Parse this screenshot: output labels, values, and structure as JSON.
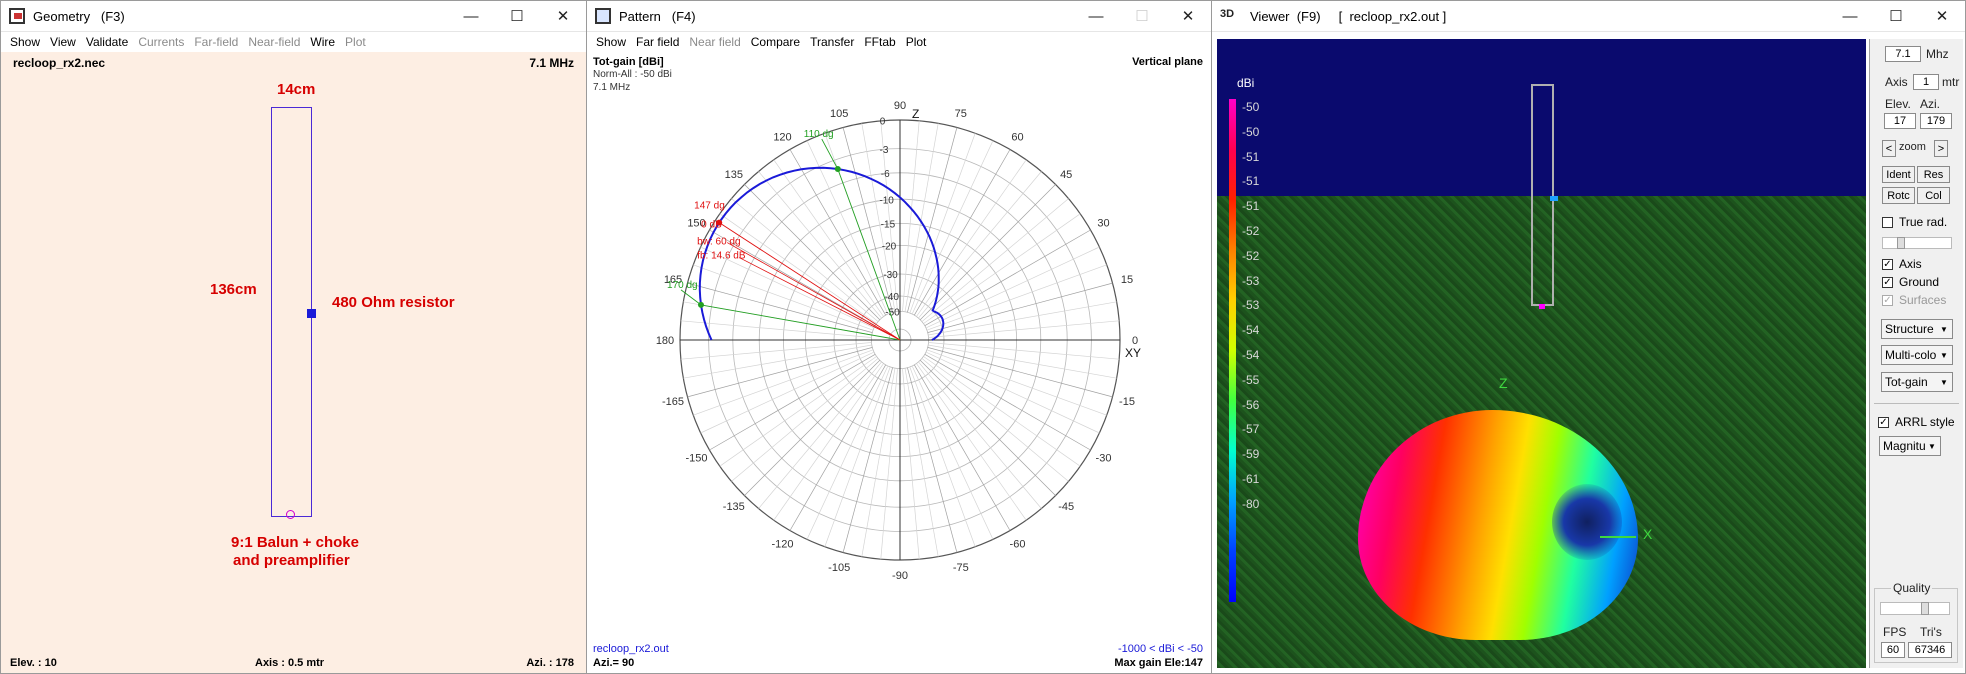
{
  "geometry": {
    "title": "Geometry   (F3)",
    "menu": [
      {
        "label": "Show",
        "enabled": true
      },
      {
        "label": "View",
        "enabled": true
      },
      {
        "label": "Validate",
        "enabled": true
      },
      {
        "label": "Currents",
        "enabled": false
      },
      {
        "label": "Far-field",
        "enabled": false
      },
      {
        "label": "Near-field",
        "enabled": false
      },
      {
        "label": "Wire",
        "enabled": true
      },
      {
        "label": "Plot",
        "enabled": false
      }
    ],
    "filename": "recloop_rx2.nec",
    "frequency": "7.1 MHz",
    "width_label": "14cm",
    "height_label": "136cm",
    "resistor_label": "480 Ohm resistor",
    "balun_label_1": "9:1 Balun + choke",
    "balun_label_2": "and preamplifier",
    "elev": "Elev. : 10",
    "axis": "Axis : 0.5 mtr",
    "azi": "Azi. : 178"
  },
  "pattern": {
    "title": "Pattern   (F4)",
    "menu": [
      {
        "label": "Show",
        "enabled": true
      },
      {
        "label": "Far field",
        "enabled": true
      },
      {
        "label": "Near field",
        "enabled": false
      },
      {
        "label": "Compare",
        "enabled": true
      },
      {
        "label": "Transfer",
        "enabled": true
      },
      {
        "label": "FFtab",
        "enabled": true
      },
      {
        "label": "Plot",
        "enabled": true
      }
    ],
    "heading": "Tot-gain [dBi]",
    "norm": "Norm-All : -50 dBi",
    "freq": "7.1 MHz",
    "plane": "Vertical plane",
    "filename": "recloop_rx2.out",
    "azi": "Azi.= 90",
    "range": "-1000 < dBi < -50",
    "maxgain": "Max gain Ele:147",
    "z_label": "Z",
    "xy_label": "XY",
    "angle_labels": [
      "90",
      "75",
      "60",
      "45",
      "30",
      "15",
      "0",
      "-15",
      "-30",
      "-45",
      "-60",
      "-75",
      "-90",
      "-105",
      "-120",
      "-135",
      "-150",
      "-165",
      "180",
      "165",
      "150",
      "135",
      "120",
      "105"
    ],
    "ring_labels": [
      "0",
      "-3",
      "-6",
      "-10",
      "-15",
      "-20",
      "-30",
      "-40",
      "-50"
    ],
    "marker_110": "110 dg",
    "marker_170": "170 dg",
    "marker_147": "147 dg",
    "marker_db": "0 dB",
    "marker_bw": "bw: 60 dg",
    "marker_fb": "fb: 14.6 dB"
  },
  "viewer": {
    "title": "Viewer  (F9)     [  recloop_rx2.out ]",
    "legend_title": "dBi",
    "legend_values": [
      "-50",
      "-50",
      "-51",
      "-51",
      "-51",
      "-52",
      "-52",
      "-53",
      "-53",
      "-54",
      "-54",
      "-55",
      "-56",
      "-57",
      "-59",
      "-61",
      "-80"
    ],
    "axis_z": "Z",
    "axis_x": "X",
    "panel": {
      "freq": "7.1",
      "freq_unit": "Mhz",
      "axis_label": "Axis",
      "axis_value": "1",
      "axis_unit": "mtr",
      "elev_label": "Elev.",
      "azi_label": "Azi.",
      "elev_value": "17",
      "azi_value": "179",
      "zoom_left": "<",
      "zoom_label": "zoom",
      "zoom_right": ">",
      "ident": "Ident",
      "res": "Res",
      "rotc": "Rotc",
      "col": "Col",
      "true_rad": "True rad.",
      "axis_chk": "Axis",
      "ground_chk": "Ground",
      "surfaces_chk": "Surfaces",
      "sel_structure": "Structure",
      "sel_multicolor": "Multi-colo",
      "sel_totgain": "Tot-gain",
      "arrl": "ARRL style",
      "sel_magnitude": "Magnitu",
      "quality": "Quality",
      "fps_label": "FPS",
      "tris_label": "Tri's",
      "fps_value": "60",
      "tris_value": "67346"
    }
  },
  "colors": {
    "geom_bg": "#fdeee3",
    "loop": "#4a2ad6",
    "accent_red": "#d60000",
    "pattern_blue": "#1a1ad8",
    "sky": "#0a0a6e",
    "ground": "#1e5a1e"
  }
}
